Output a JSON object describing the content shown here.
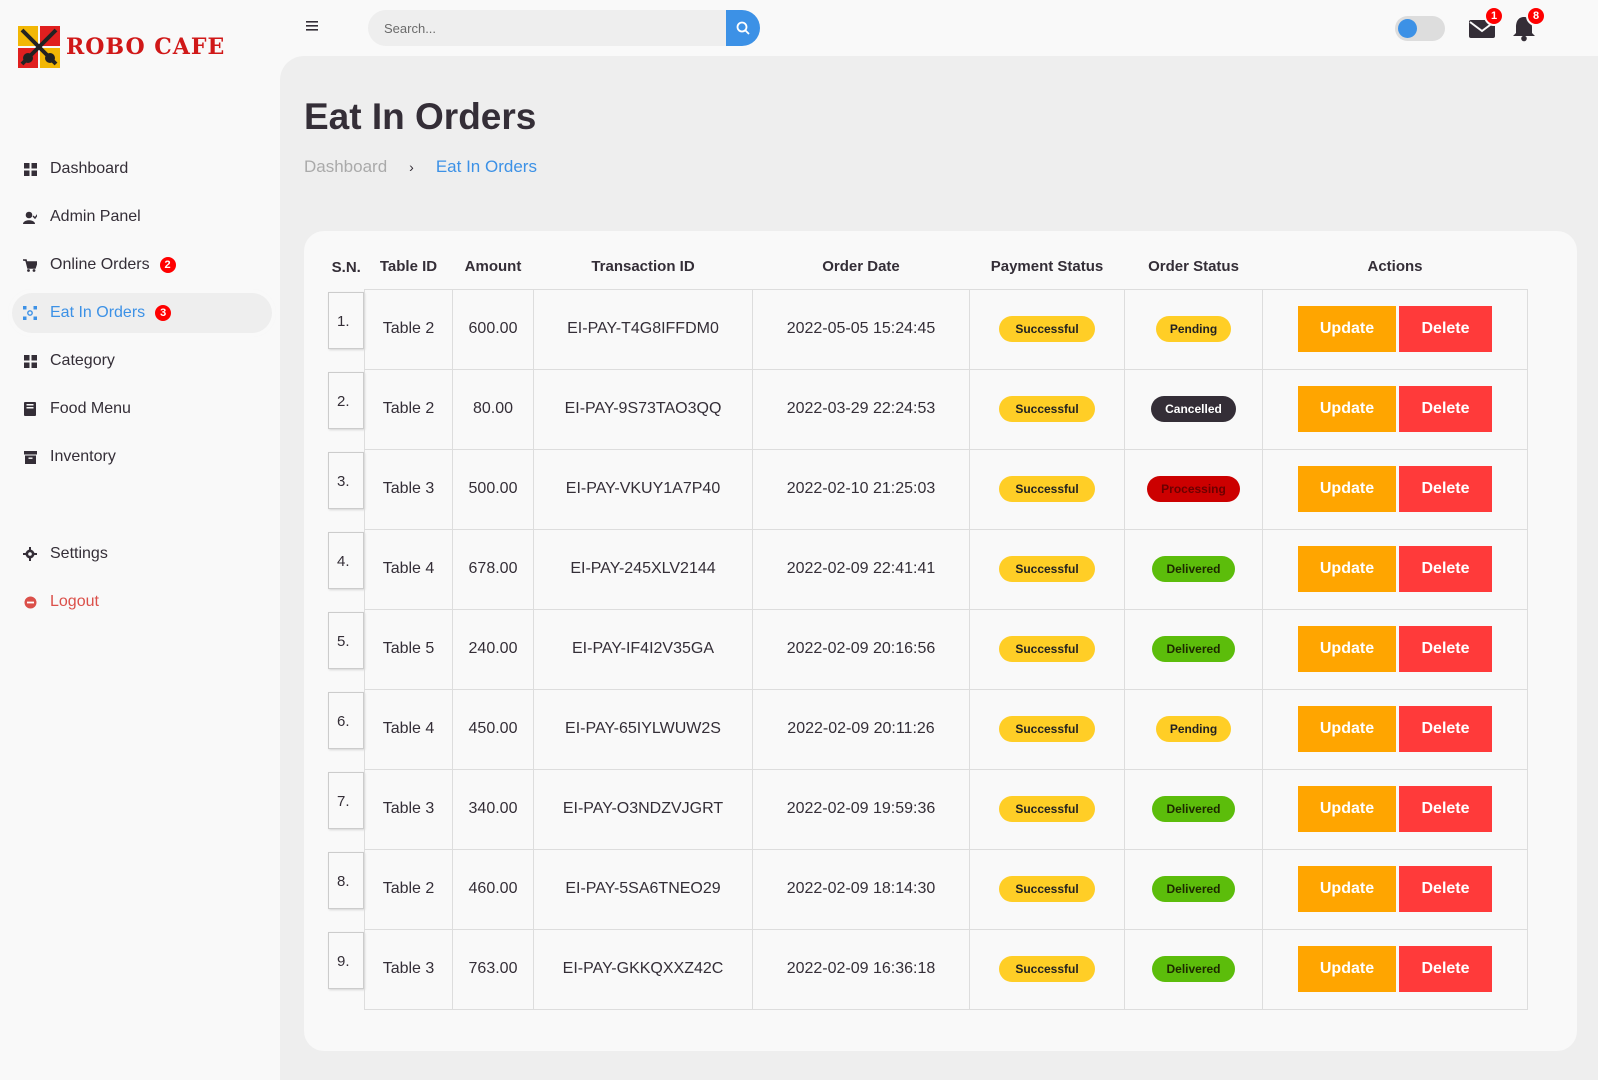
{
  "brand": {
    "name": "ROBO CAFE"
  },
  "sidebar": {
    "items": [
      {
        "label": "Dashboard",
        "icon": "dashboard-icon"
      },
      {
        "label": "Admin Panel",
        "icon": "user-icon"
      },
      {
        "label": "Online Orders",
        "icon": "cart-icon",
        "badge": "2"
      },
      {
        "label": "Eat In Orders",
        "icon": "dine-icon",
        "badge": "3",
        "active": true
      },
      {
        "label": "Category",
        "icon": "category-icon"
      },
      {
        "label": "Food Menu",
        "icon": "book-icon"
      },
      {
        "label": "Inventory",
        "icon": "archive-icon"
      }
    ],
    "bottom": [
      {
        "label": "Settings",
        "icon": "gear-icon"
      },
      {
        "label": "Logout",
        "icon": "logout-icon"
      }
    ]
  },
  "topnav": {
    "search_placeholder": "Search...",
    "mail_count": "1",
    "notification_count": "8"
  },
  "page": {
    "title": "Eat In Orders",
    "breadcrumb": [
      "Dashboard",
      "Eat In Orders"
    ]
  },
  "table": {
    "headers": [
      "S.N.",
      "Table ID",
      "Amount",
      "Transaction ID",
      "Order Date",
      "Payment Status",
      "Order Status",
      "Actions"
    ],
    "update_label": "Update",
    "delete_label": "Delete",
    "rows": [
      {
        "sn": "1.",
        "table": "Table 2",
        "amount": "600.00",
        "txn": "EI-PAY-T4G8IFFDM0",
        "date": "2022-05-05 15:24:45",
        "payment": "Successful",
        "status": "Pending"
      },
      {
        "sn": "2.",
        "table": "Table 2",
        "amount": "80.00",
        "txn": "EI-PAY-9S73TAO3QQ",
        "date": "2022-03-29 22:24:53",
        "payment": "Successful",
        "status": "Cancelled"
      },
      {
        "sn": "3.",
        "table": "Table 3",
        "amount": "500.00",
        "txn": "EI-PAY-VKUY1A7P40",
        "date": "2022-02-10 21:25:03",
        "payment": "Successful",
        "status": "Processing"
      },
      {
        "sn": "4.",
        "table": "Table 4",
        "amount": "678.00",
        "txn": "EI-PAY-245XLV2144",
        "date": "2022-02-09 22:41:41",
        "payment": "Successful",
        "status": "Delivered"
      },
      {
        "sn": "5.",
        "table": "Table 5",
        "amount": "240.00",
        "txn": "EI-PAY-IF4I2V35GA",
        "date": "2022-02-09 20:16:56",
        "payment": "Successful",
        "status": "Delivered"
      },
      {
        "sn": "6.",
        "table": "Table 4",
        "amount": "450.00",
        "txn": "EI-PAY-65IYLWUW2S",
        "date": "2022-02-09 20:11:26",
        "payment": "Successful",
        "status": "Pending"
      },
      {
        "sn": "7.",
        "table": "Table 3",
        "amount": "340.00",
        "txn": "EI-PAY-O3NDZVJGRT",
        "date": "2022-02-09 19:59:36",
        "payment": "Successful",
        "status": "Delivered"
      },
      {
        "sn": "8.",
        "table": "Table 2",
        "amount": "460.00",
        "txn": "EI-PAY-5SA6TNEO29",
        "date": "2022-02-09 18:14:30",
        "payment": "Successful",
        "status": "Delivered"
      },
      {
        "sn": "9.",
        "table": "Table 3",
        "amount": "763.00",
        "txn": "EI-PAY-GKKQXXZ42C",
        "date": "2022-02-09 16:36:18",
        "payment": "Successful",
        "status": "Delivered"
      }
    ]
  },
  "colors": {
    "accent": "#3c91e6",
    "brand_red": "#d01818",
    "update": "#ffa500",
    "delete": "#ff3a3a",
    "pending": "#ffce26",
    "cancelled": "#342e37",
    "processing": "#cc0000",
    "delivered": "#5cbd0b"
  }
}
